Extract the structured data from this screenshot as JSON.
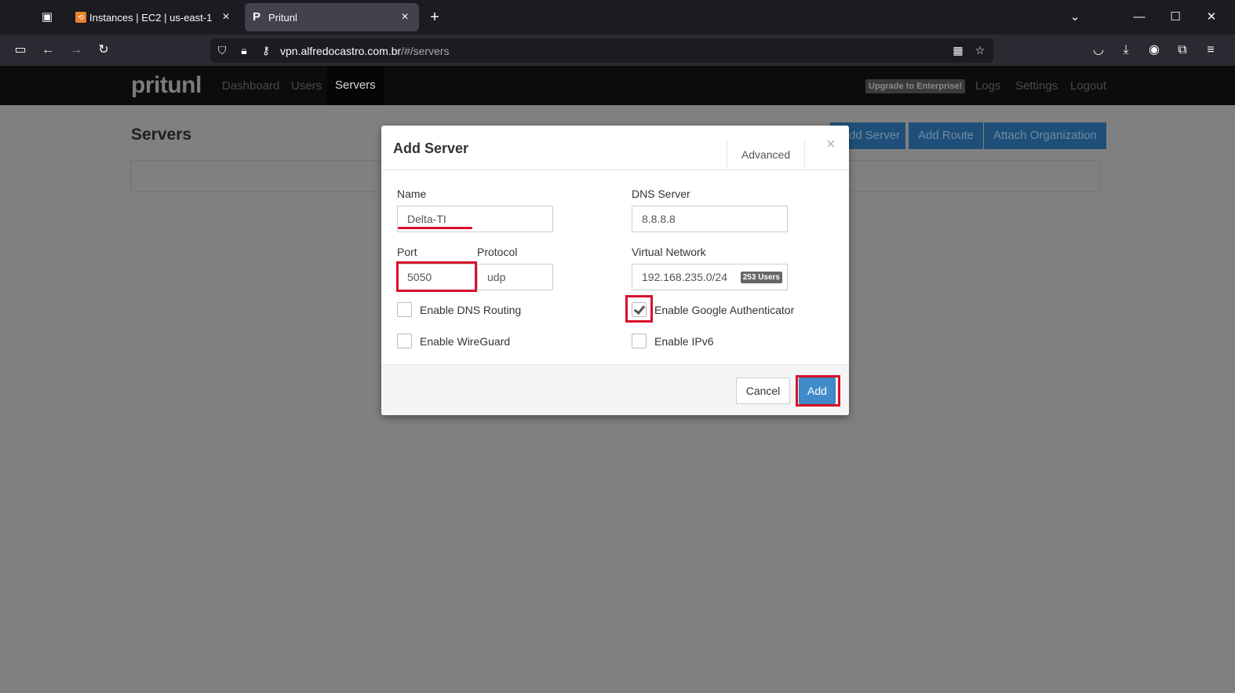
{
  "browser": {
    "tabs": [
      {
        "title": "Instances | EC2 | us-east-1",
        "icon": "aws-icon"
      },
      {
        "title": "Pritunl",
        "icon": "pritunl-icon",
        "active": true
      }
    ],
    "url_domain": "vpn.alfredocastro.com.br",
    "url_path": "/#/servers"
  },
  "app": {
    "brand": "pritunl",
    "nav": [
      "Dashboard",
      "Users",
      "Servers"
    ],
    "active_nav": "Servers",
    "upgrade_label": "Upgrade to Enterprise!",
    "right_nav": [
      "Logs",
      "Settings",
      "Logout"
    ],
    "page_title": "Servers",
    "actions": [
      "dd Server",
      "Add Route",
      "Attach Organization"
    ]
  },
  "modal": {
    "title": "Add Server",
    "advanced_tab": "Advanced",
    "close_symbol": "×",
    "fields": {
      "name": {
        "label": "Name",
        "value": "Delta-TI"
      },
      "port": {
        "label": "Port",
        "value": "5050"
      },
      "protocol": {
        "label": "Protocol",
        "value": "udp"
      },
      "dns": {
        "label": "DNS Server",
        "value": "8.8.8.8"
      },
      "vnet": {
        "label": "Virtual Network",
        "value": "192.168.235.0/24",
        "badge": "253 Users"
      }
    },
    "checkboxes": {
      "dns_routing": {
        "label": "Enable DNS Routing",
        "checked": false
      },
      "wireguard": {
        "label": "Enable WireGuard",
        "checked": false
      },
      "google_auth": {
        "label": "Enable Google Authenticator",
        "checked": true
      },
      "ipv6": {
        "label": "Enable IPv6",
        "checked": false
      }
    },
    "cancel_label": "Cancel",
    "add_label": "Add"
  },
  "colors": {
    "highlight": "#d7102a",
    "primary_button": "#428bca",
    "overlay": "#808080"
  }
}
